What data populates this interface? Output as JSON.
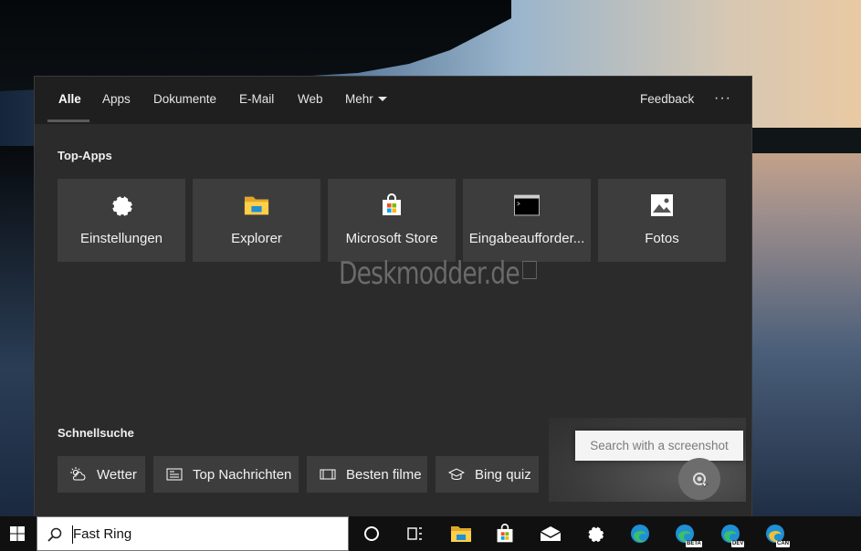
{
  "tabs": [
    {
      "label": "Alle"
    },
    {
      "label": "Apps"
    },
    {
      "label": "Dokumente"
    },
    {
      "label": "E-Mail"
    },
    {
      "label": "Web"
    },
    {
      "label": "Mehr"
    }
  ],
  "header": {
    "feedback_label": "Feedback",
    "more_dots": "···"
  },
  "top_apps": {
    "title": "Top-Apps",
    "items": [
      {
        "label": "Einstellungen",
        "icon": "gear-icon"
      },
      {
        "label": "Explorer",
        "icon": "folder-icon"
      },
      {
        "label": "Microsoft Store",
        "icon": "store-bag-icon"
      },
      {
        "label": "Eingabeaufforder...",
        "icon": "terminal-icon"
      },
      {
        "label": "Fotos",
        "icon": "photo-icon"
      }
    ]
  },
  "watermark": {
    "text": "Deskmodder.de"
  },
  "quick_search": {
    "title": "Schnellsuche",
    "items": [
      {
        "label": "Wetter",
        "icon": "weather-icon"
      },
      {
        "label": "Top Nachrichten",
        "icon": "news-icon"
      },
      {
        "label": "Besten filme",
        "icon": "film-icon"
      },
      {
        "label": "Bing quiz",
        "icon": "graduation-cap-icon"
      }
    ]
  },
  "promo": {
    "text": "Search with a screenshot"
  },
  "taskbar": {
    "search_value": "Fast Ring",
    "badges": {
      "beta": "BETA",
      "dev": "DEV",
      "can": "CAN"
    }
  },
  "colors": {
    "panel_bg": "#2b2b2b",
    "tabbar_bg": "#1f1f1f",
    "tile_bg": "#3d3d3d",
    "taskbar_bg": "#101010",
    "edge_blue": "#1f8fd6",
    "edge_green": "#3bbf6a"
  }
}
